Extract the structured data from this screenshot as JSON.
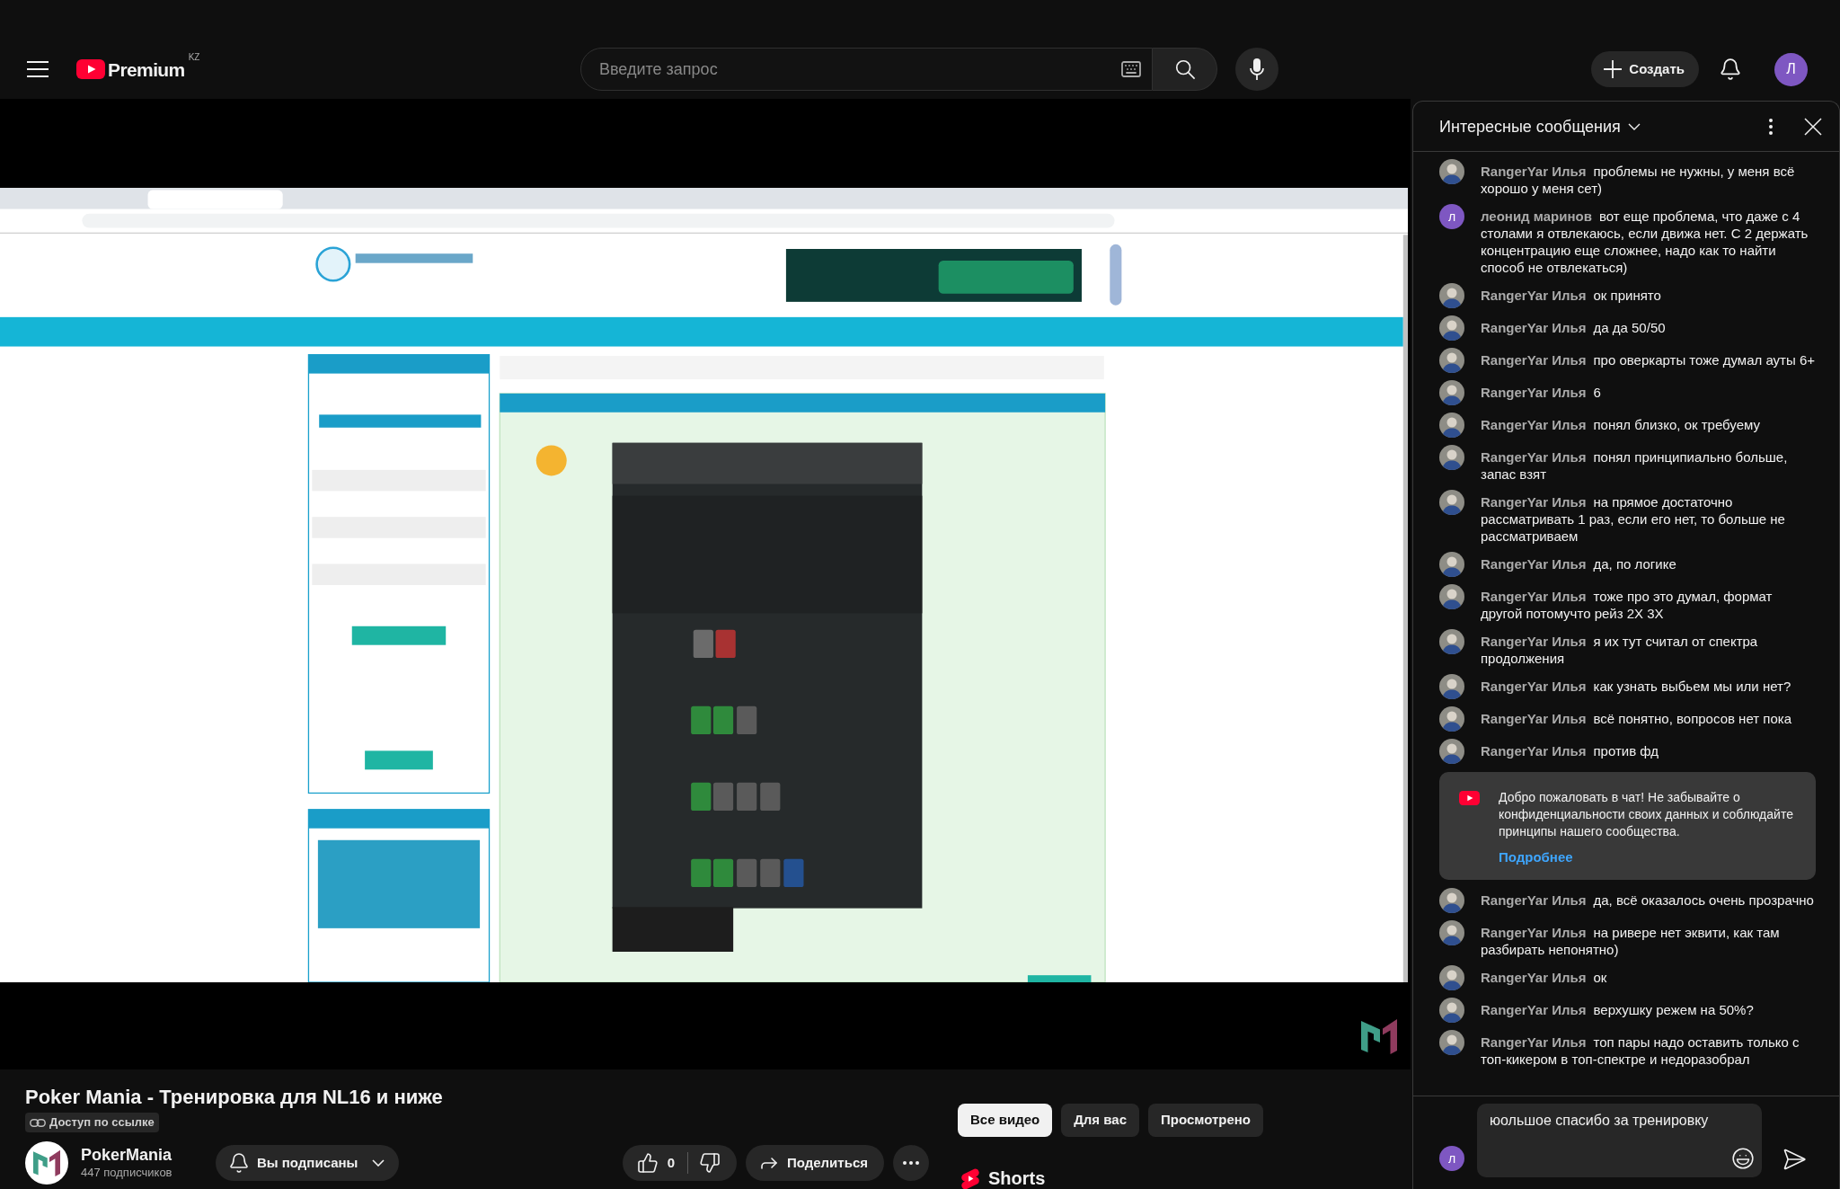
{
  "top_bar": {
    "brand": "Premium",
    "region": "KZ",
    "search": {
      "placeholder": "Введите запрос"
    },
    "create_button": "Создать",
    "account_initial": "Л"
  },
  "video_info": {
    "title": "Poker Mania - Тренировка для NL16 и ниже",
    "visibility": "Доступ по ссылке",
    "channel": {
      "name": "PokerMania",
      "subscribers": "447 подписчиков"
    },
    "subscribe_button": "Вы подписаны",
    "likes": "0",
    "share_button": "Поделиться"
  },
  "filter_chips": [
    {
      "label": "Все видео",
      "selected": true
    },
    {
      "label": "Для вас",
      "selected": false
    },
    {
      "label": "Просмотрено",
      "selected": false
    }
  ],
  "shelf": {
    "title": "Shorts"
  },
  "chat": {
    "title": "Интересные сообщения",
    "items": [
      {
        "kind": "message",
        "avatar": {
          "kind": "photo"
        },
        "author": "RangerYar Илья",
        "text": "проблемы не нужны, у меня всё хорошо у меня сет)"
      },
      {
        "kind": "message",
        "avatar": {
          "kind": "letter",
          "letter": "л"
        },
        "author": "леонид маринов",
        "text": "вот еще проблема, что даже с 4 столами я отвлекаюсь, если движа нет. С 2 держать концентрацию еще сложнее, надо как то найти способ не отвлекаться)"
      },
      {
        "kind": "message",
        "avatar": {
          "kind": "photo"
        },
        "author": "RangerYar Илья",
        "text": "ок принято"
      },
      {
        "kind": "message",
        "avatar": {
          "kind": "photo"
        },
        "author": "RangerYar Илья",
        "text": "да да 50/50"
      },
      {
        "kind": "message",
        "avatar": {
          "kind": "photo"
        },
        "author": "RangerYar Илья",
        "text": "про оверкарты тоже думал ауты 6+"
      },
      {
        "kind": "message",
        "avatar": {
          "kind": "photo"
        },
        "author": "RangerYar Илья",
        "text": "6"
      },
      {
        "kind": "message",
        "avatar": {
          "kind": "photo"
        },
        "author": "RangerYar Илья",
        "text": "понял близко, ок требуему"
      },
      {
        "kind": "message",
        "avatar": {
          "kind": "photo"
        },
        "author": "RangerYar Илья",
        "text": "понял принципиально больше, запас взят"
      },
      {
        "kind": "message",
        "avatar": {
          "kind": "photo"
        },
        "author": "RangerYar Илья",
        "text": "на прямое достаточно рассматривать 1 раз, если его нет, то больше не рассматриваем"
      },
      {
        "kind": "message",
        "avatar": {
          "kind": "photo"
        },
        "author": "RangerYar Илья",
        "text": "да, по логике"
      },
      {
        "kind": "message",
        "avatar": {
          "kind": "photo"
        },
        "author": "RangerYar Илья",
        "text": "тоже про это думал, формат другой потомучто рейз 2X 3X"
      },
      {
        "kind": "message",
        "avatar": {
          "kind": "photo"
        },
        "author": "RangerYar Илья",
        "text": "я их тут считал от спектра продолжения"
      },
      {
        "kind": "message",
        "avatar": {
          "kind": "photo"
        },
        "author": "RangerYar Илья",
        "text": "как узнать выбьем мы или нет?"
      },
      {
        "kind": "message",
        "avatar": {
          "kind": "photo"
        },
        "author": "RangerYar Илья",
        "text": "всё понятно, вопросов нет пока"
      },
      {
        "kind": "message",
        "avatar": {
          "kind": "photo"
        },
        "author": "RangerYar Илья",
        "text": "против фд"
      },
      {
        "kind": "notice",
        "text": "Добро пожаловать в чат! Не забывайте о конфиденциальности своих данных и соблюдайте принципы нашего сообщества.",
        "link": "Подробнее"
      },
      {
        "kind": "message",
        "avatar": {
          "kind": "photo"
        },
        "author": "RangerYar Илья",
        "text": "да, всё оказалось очень прозрачно"
      },
      {
        "kind": "message",
        "avatar": {
          "kind": "photo"
        },
        "author": "RangerYar Илья",
        "text": "на ривере нет эквити, как там разбирать непонятно)"
      },
      {
        "kind": "message",
        "avatar": {
          "kind": "photo"
        },
        "author": "RangerYar Илья",
        "text": "ок"
      },
      {
        "kind": "message",
        "avatar": {
          "kind": "photo"
        },
        "author": "RangerYar Илья",
        "text": "верхушку режем на 50%?"
      },
      {
        "kind": "message",
        "avatar": {
          "kind": "photo"
        },
        "author": "RangerYar Илья",
        "text": "топ пары надо оставить только с топ-кикером в топ-спектре и недоразобрал"
      }
    ],
    "input": {
      "avatar_initial": "л",
      "value": "юольшое спасибо за тренировку"
    }
  }
}
